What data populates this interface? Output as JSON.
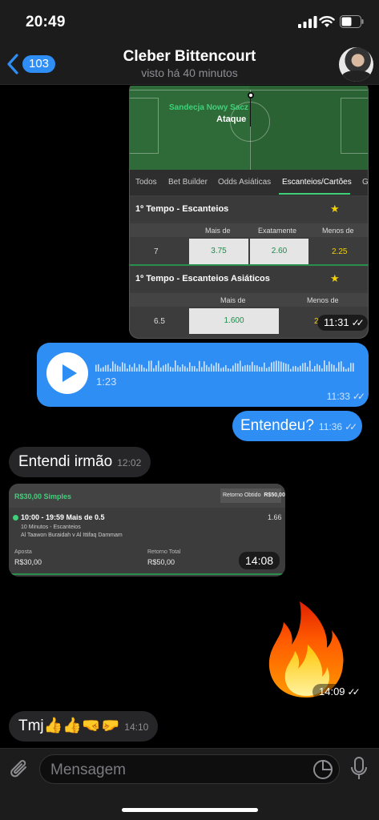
{
  "status_bar": {
    "time": "20:49"
  },
  "header": {
    "back_count": "103",
    "title": "Cleber Bittencourt",
    "subtitle": "visto há 40 minutos"
  },
  "messages": {
    "bet_screenshot": {
      "team": "Sandecja Nowy Sacz",
      "attack_label": "Ataque",
      "tabs": [
        "Todos",
        "Bet Builder",
        "Odds Asiáticas",
        "Escanteios/Cartões",
        "Go"
      ],
      "section1": {
        "title": "1º Tempo - Escanteios",
        "col_over": "Mais de",
        "col_exact": "Exatamente",
        "col_under": "Menos de",
        "line": "7",
        "over": "3.75",
        "exact": "2.60",
        "under": "2.25"
      },
      "section2": {
        "title": "1º Tempo - Escanteios Asiáticos",
        "col_over": "Mais de",
        "col_under": "Menos de",
        "line": "6.5",
        "over": "1.600",
        "under": "2"
      },
      "time": "11:31"
    },
    "voice": {
      "duration": "1:23",
      "time": "11:33"
    },
    "entendeu": {
      "text": "Entendeu?",
      "time": "11:36"
    },
    "entendi": {
      "text": "Entendi irmão",
      "time": "12:02"
    },
    "bet_receipt": {
      "title": "R$30,00 Simples",
      "retorno_label": "Retorno Obtido",
      "retorno_value": "R$50,00",
      "selection": "10:00 - 19:59 Mais de 0.5",
      "odd": "1.66",
      "market": "10 Minutos - Escanteios",
      "match": "Al Taawon Buraidah v Al Ittifaq Dammam",
      "stake_label": "Aposta",
      "stake_value": "R$30,00",
      "total_label": "Retorno Total",
      "total_value": "R$50,00",
      "time": "14:08"
    },
    "fire": {
      "emoji": "🔥",
      "time": "14:09"
    },
    "tmj": {
      "text": "Tmj👍👍🤜🤛",
      "time": "14:10"
    }
  },
  "input": {
    "placeholder": "Mensagem"
  },
  "colors": {
    "accent": "#2f8ef4",
    "incoming": "#262628",
    "bar": "#1c1c1d",
    "bet_green": "#41d07a"
  }
}
